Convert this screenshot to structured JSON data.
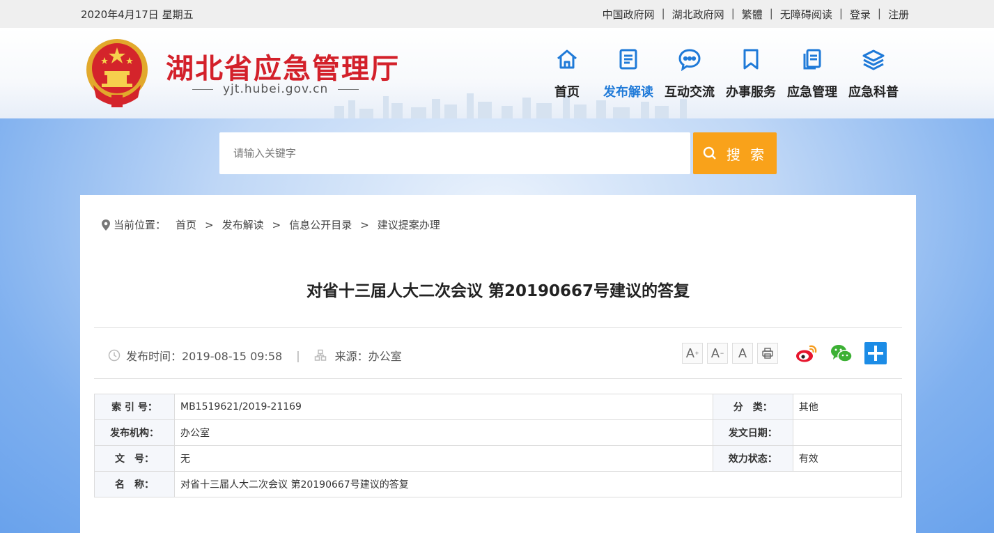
{
  "topbar": {
    "date": "2020年4月17日 星期五",
    "links": [
      "中国政府网",
      "湖北政府网",
      "繁體",
      "无障碍阅读",
      "登录",
      "注册"
    ]
  },
  "header": {
    "title": "湖北省应急管理厅",
    "domain": "yjt.hubei.gov.cn",
    "nav": [
      {
        "label": "首页",
        "icon": "home-icon"
      },
      {
        "label": "发布解读",
        "icon": "document-icon"
      },
      {
        "label": "互动交流",
        "icon": "chat-icon"
      },
      {
        "label": "办事服务",
        "icon": "bookmark-icon"
      },
      {
        "label": "应急管理",
        "icon": "files-icon"
      },
      {
        "label": "应急科普",
        "icon": "layers-icon"
      }
    ],
    "active_nav": "发布解读"
  },
  "search": {
    "placeholder": "请输入关键字",
    "button_label": "搜 索"
  },
  "breadcrumb": {
    "label": "当前位置：",
    "items": [
      "首页",
      "发布解读",
      "信息公开目录",
      "建议提案办理"
    ]
  },
  "article": {
    "title": "对省十三届人大二次会议 第20190667号建议的答复",
    "publish_time": "发布时间：2019-08-15 09:58",
    "source": "来源：办公室"
  },
  "tools": {
    "font_large": "A",
    "font_small": "A",
    "font_default": "A"
  },
  "info_table": {
    "index_key": "索 引 号：",
    "index_val": "MB1519621/2019-21169",
    "category_key": "分　类：",
    "category_val": "其他",
    "org_key": "发布机构：",
    "org_val": "办公室",
    "date_key": "发文日期：",
    "date_val": "",
    "docno_key": "文　号：",
    "docno_val": "无",
    "status_key": "效力状态：",
    "status_val": "有效",
    "name_key": "名　称：",
    "name_val": "对省十三届人大二次会议 第20190667号建议的答复"
  },
  "colors": {
    "brand_red": "#d3202a",
    "nav_active": "#1f7ad8",
    "search_button": "#f9a21a"
  }
}
